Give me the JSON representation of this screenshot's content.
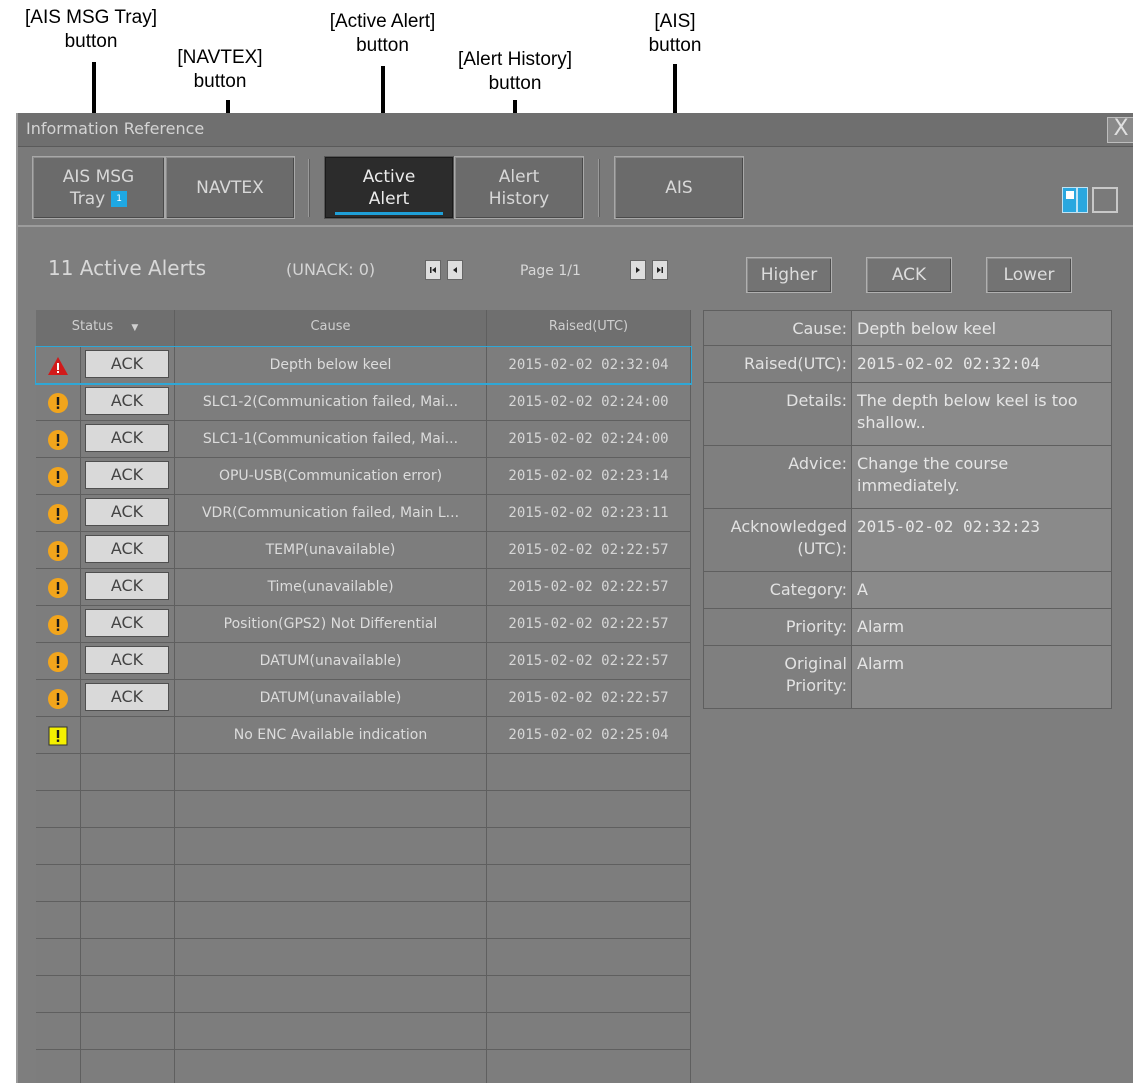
{
  "callouts": {
    "ais_msg_tray_line1": "[AIS MSG Tray]",
    "ais_msg_tray_line2": "button",
    "navtex_line1": "[NAVTEX]",
    "navtex_line2": "button",
    "active_alert_line1": "[Active Alert]",
    "active_alert_line2": "button",
    "alert_history_line1": "[Alert History]",
    "alert_history_line2": "button",
    "ais_line1": "[AIS]",
    "ais_line2": "button"
  },
  "window": {
    "title": "Information Reference",
    "close_symbol": "X"
  },
  "toolbar": {
    "ais_msg_tray": {
      "line1": "AIS MSG",
      "line2": "Tray",
      "badge": "1"
    },
    "navtex": "NAVTEX",
    "active_alert": {
      "line1": "Active",
      "line2": "Alert"
    },
    "alert_history": {
      "line1": "Alert",
      "line2": "History"
    },
    "ais": "AIS"
  },
  "header": {
    "title": "11 Active Alerts",
    "unack": "(UNACK: 0)",
    "page": "Page 1/1",
    "higher": "Higher",
    "ack": "ACK",
    "lower": "Lower"
  },
  "table": {
    "columns": {
      "status": "Status",
      "cause": "Cause",
      "raised": "Raised(UTC)"
    },
    "rows": [
      {
        "icon": "alarm-triangle-icon",
        "ack": "ACK",
        "cause": "Depth below keel",
        "raised": "2015-02-02 02:32:04",
        "selected": true
      },
      {
        "icon": "warning-circle-icon",
        "ack": "ACK",
        "cause": "SLC1-2(Communication failed, Mai...",
        "raised": "2015-02-02 02:24:00"
      },
      {
        "icon": "warning-circle-icon",
        "ack": "ACK",
        "cause": "SLC1-1(Communication failed, Mai...",
        "raised": "2015-02-02 02:24:00"
      },
      {
        "icon": "warning-circle-icon",
        "ack": "ACK",
        "cause": "OPU-USB(Communication error)",
        "raised": "2015-02-02 02:23:14"
      },
      {
        "icon": "warning-circle-icon",
        "ack": "ACK",
        "cause": "VDR(Communication failed, Main L...",
        "raised": "2015-02-02 02:23:11"
      },
      {
        "icon": "warning-circle-icon",
        "ack": "ACK",
        "cause": "TEMP(unavailable)",
        "raised": "2015-02-02 02:22:57"
      },
      {
        "icon": "warning-circle-icon",
        "ack": "ACK",
        "cause": "Time(unavailable)",
        "raised": "2015-02-02 02:22:57"
      },
      {
        "icon": "warning-circle-icon",
        "ack": "ACK",
        "cause": "Position(GPS2) Not Differential",
        "raised": "2015-02-02 02:22:57"
      },
      {
        "icon": "warning-circle-icon",
        "ack": "ACK",
        "cause": "DATUM(unavailable)",
        "raised": "2015-02-02 02:22:57"
      },
      {
        "icon": "warning-circle-icon",
        "ack": "ACK",
        "cause": "DATUM(unavailable)",
        "raised": "2015-02-02 02:22:57"
      },
      {
        "icon": "caution-square-icon",
        "ack": "",
        "cause": "No ENC Available indication",
        "raised": "2015-02-02 02:25:04"
      }
    ]
  },
  "detail": [
    {
      "label": "Cause:",
      "value": "Depth below keel"
    },
    {
      "label": "Raised(UTC):",
      "value": "2015-02-02 02:32:04"
    },
    {
      "label": "Details:",
      "value": "The depth below keel is too shallow.."
    },
    {
      "label": "Advice:",
      "value": "Change the course immediately."
    },
    {
      "label": "Acknowledged (UTC):",
      "value": "2015-02-02 02:32:23"
    },
    {
      "label": "Category:",
      "value": "A"
    },
    {
      "label": "Priority:",
      "value": "Alarm"
    },
    {
      "label": "Original Priority:",
      "value": "Alarm"
    }
  ],
  "colors": {
    "accent": "#1f9fd7",
    "alarm": "#d11a1a",
    "warning": "#f2a51c",
    "caution": "#f5f000"
  }
}
